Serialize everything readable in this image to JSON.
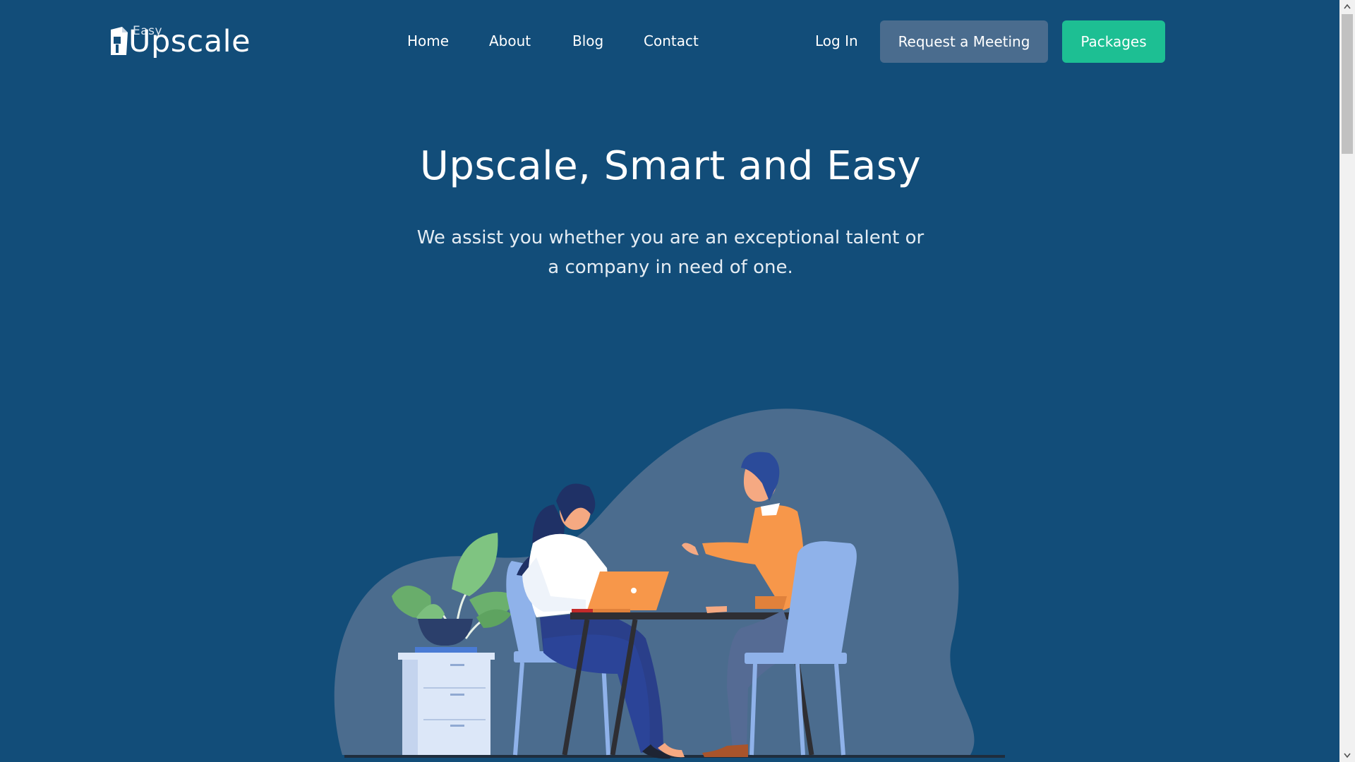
{
  "header": {
    "logo_small": "Easy",
    "logo_big": "Upscale",
    "nav": [
      "Home",
      "About",
      "Blog",
      "Contact"
    ],
    "login_label": "Log In",
    "meeting_label": "Request a Meeting",
    "packages_label": "Packages"
  },
  "hero": {
    "title": "Upscale, Smart and Easy",
    "subtitle": "We assist you whether you are an exceptional talent or a company in need of one."
  },
  "colors": {
    "background": "#124d79",
    "primary_button": "#1dbf93",
    "secondary_button": "#4a6c8e"
  },
  "icons": {
    "logo": "upscale-logo-icon",
    "scroll_up": "arrow-up-icon",
    "scroll_down": "arrow-down-icon"
  }
}
